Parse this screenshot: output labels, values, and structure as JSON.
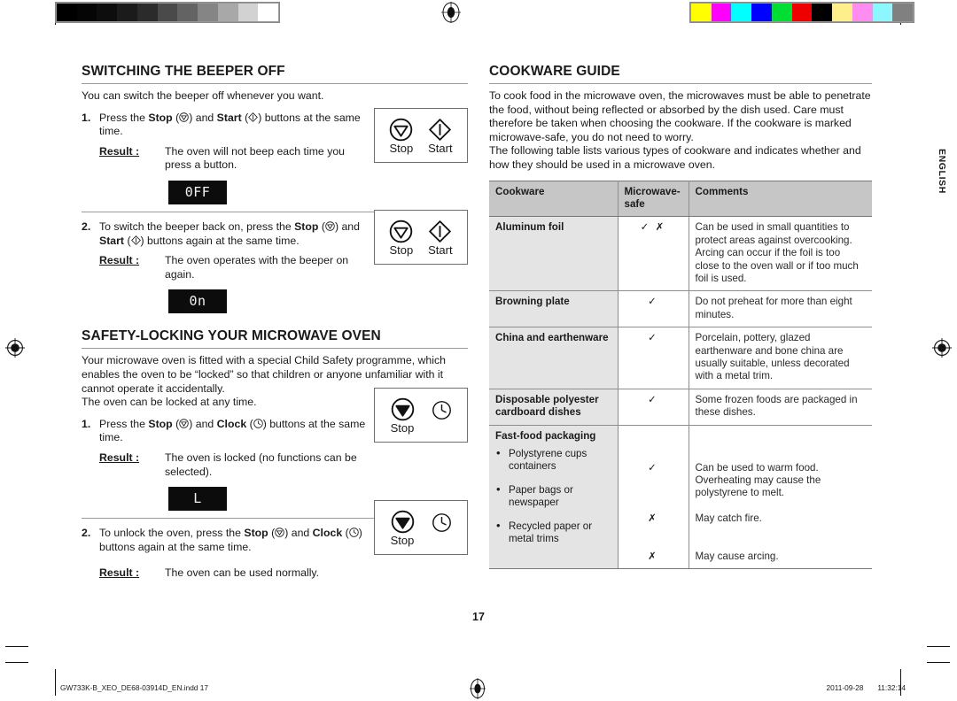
{
  "document": {
    "page_number": "17",
    "language_tab": "ENGLISH",
    "footer": {
      "filename": "GW733K-B_XEO_DE68-03914D_EN.indd   17",
      "date": "2011-09-28",
      "time": "11:32:14"
    }
  },
  "print_marks": {
    "grayscale_bar": [
      "#000000",
      "#050505",
      "#0d0d0d",
      "#1b1b1b",
      "#2b2b2b",
      "#4a4a4a",
      "#636363",
      "#858585",
      "#a8a8a8",
      "#d2d2d2",
      "#ffffff"
    ],
    "color_bar": [
      "#ffff00",
      "#ff00ff",
      "#00ffff",
      "#0000ff",
      "#00dd33",
      "#ee0000",
      "#000000",
      "#ffef8c",
      "#ff8cf0",
      "#8cf7ff",
      "#808080"
    ]
  },
  "left_column": {
    "beeper_section": {
      "title": "Switching the Beeper Off",
      "intro": "You can switch the beeper off whenever you want.",
      "steps": [
        {
          "number": "1.",
          "text_parts": {
            "a": "Press the ",
            "bold1": "Stop",
            "b": " (",
            "icon1": "stop-icon",
            "c": ") and ",
            "bold2": "Start",
            "d": " (",
            "icon2": "start-icon",
            "e": ") buttons at the same time."
          },
          "result_label": "Result :",
          "result_text": "The oven will not beep each time you press a button.",
          "led_value": "0FF",
          "buttons": [
            {
              "glyph": "stop-icon",
              "caption": "Stop"
            },
            {
              "glyph": "start-icon",
              "caption": "Start"
            }
          ]
        },
        {
          "number": "2.",
          "text_parts": {
            "a": "To switch the beeper back on, press the ",
            "bold1": "Stop",
            "b": " (",
            "icon1": "stop-icon",
            "c": ") and ",
            "bold2": "Start",
            "d": " (",
            "icon2": "start-icon",
            "e": ") buttons again at the same time."
          },
          "result_label": "Result :",
          "result_text": "The oven operates with the beeper on again.",
          "led_value": "0n",
          "buttons": [
            {
              "glyph": "stop-icon",
              "caption": "Stop"
            },
            {
              "glyph": "start-icon",
              "caption": "Start"
            }
          ]
        }
      ]
    },
    "safety_section": {
      "title": "Safety-Locking Your Microwave Oven",
      "intro_1": "Your microwave oven is fitted with a special Child Safety programme, which enables the oven to be “locked” so that children or anyone unfamiliar with it cannot operate it accidentally.",
      "intro_2": "The oven can be locked at any time.",
      "steps": [
        {
          "number": "1.",
          "text_parts": {
            "a": "Press the ",
            "bold1": "Stop",
            "b": " (",
            "icon1": "stop-icon",
            "c": ") and ",
            "bold2": "Clock",
            "d": " (",
            "icon2": "clock-icon",
            "e": ") buttons at the same time."
          },
          "result_label": "Result :",
          "result_text": "The oven is locked (no functions can be selected).",
          "led_value": "L",
          "buttons": [
            {
              "glyph": "stop-icon",
              "caption": "Stop"
            },
            {
              "glyph": "clock-icon",
              "caption": ""
            }
          ]
        },
        {
          "number": "2.",
          "text_parts": {
            "a": "To unlock the oven, press the ",
            "bold1": "Stop",
            "b": " (",
            "icon1": "stop-icon",
            "c": ") and ",
            "bold2": "Clock",
            "d": " (",
            "icon2": "clock-icon",
            "e": ") buttons again at the same time."
          },
          "result_label": "Result :",
          "result_text": "The oven can be used normally.",
          "led_value": "",
          "buttons": [
            {
              "glyph": "stop-icon",
              "caption": "Stop"
            },
            {
              "glyph": "clock-icon",
              "caption": ""
            }
          ]
        }
      ]
    }
  },
  "right_column": {
    "title": "Cookware Guide",
    "intro": "To cook food in the microwave oven, the microwaves must be able to penetrate the food, without being reflected or absorbed by the dish used. Care must therefore be taken when choosing the cookware. If the cookware is marked microwave-safe, you do not need to worry.",
    "intro_2": "The following table lists various types of cookware and indicates whether and how they should be used in a microwave oven.",
    "table": {
      "headers": [
        "Cookware",
        "Microwave-safe",
        "Comments"
      ],
      "rows": [
        {
          "cookware": "Aluminum foil",
          "safe": "✓ ✗",
          "comments": "Can be used in small quantities to protect areas against overcooking. Arcing can occur if the foil is too close to the oven wall or if too much foil is used."
        },
        {
          "cookware": "Browning plate",
          "safe": "✓",
          "comments": "Do not preheat for more than eight minutes."
        },
        {
          "cookware": "China and earthenware",
          "safe": "✓",
          "comments": "Porcelain, pottery, glazed earthenware and bone china are usually suitable, unless decorated with a metal trim."
        },
        {
          "cookware": "Disposable polyester cardboard dishes",
          "safe": "✓",
          "comments": "Some frozen foods are packaged in these dishes."
        },
        {
          "cookware": "Fast-food packaging",
          "safe": "",
          "comments": "",
          "subitems": [
            {
              "label": "Polystyrene cups containers",
              "safe": "✓",
              "comments": "Can be used to warm food. Overheating may cause the polystyrene to melt."
            },
            {
              "label": "Paper bags or newspaper",
              "safe": "✗",
              "comments": "May catch fire."
            },
            {
              "label": "Recycled paper or metal trims",
              "safe": "✗",
              "comments": "May cause arcing."
            }
          ]
        }
      ]
    }
  }
}
